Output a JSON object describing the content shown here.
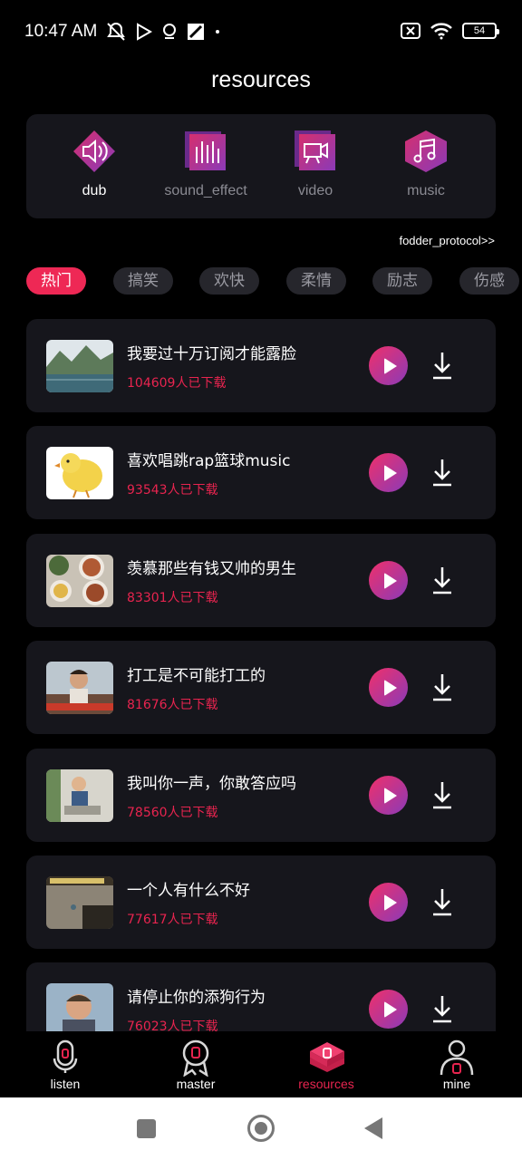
{
  "status": {
    "time": "10:47 AM",
    "battery": "54"
  },
  "title": "resources",
  "categories": [
    {
      "label": "dub",
      "icon": "speaker-icon"
    },
    {
      "label": "sound_effect",
      "icon": "equalizer-icon"
    },
    {
      "label": "video",
      "icon": "video-camera-icon"
    },
    {
      "label": "music",
      "icon": "music-note-icon"
    }
  ],
  "protocol_link": "fodder_protocol>>",
  "tabs": [
    "热门",
    "搞笑",
    "欢快",
    "柔情",
    "励志",
    "伤感"
  ],
  "items": [
    {
      "title": "我要过十万订阅才能露脸",
      "downloads": "104609人已下载"
    },
    {
      "title": "喜欢唱跳rap篮球music",
      "downloads": "93543人已下载"
    },
    {
      "title": "羡慕那些有钱又帅的男生",
      "downloads": "83301人已下载"
    },
    {
      "title": "打工是不可能打工的",
      "downloads": "81676人已下载"
    },
    {
      "title": "我叫你一声，你敢答应吗",
      "downloads": "78560人已下载"
    },
    {
      "title": "一个人有什么不好",
      "downloads": "77617人已下载"
    },
    {
      "title": "请停止你的添狗行为",
      "downloads": "76023人已下载"
    }
  ],
  "nav": [
    {
      "label": "listen",
      "icon": "microphone-icon"
    },
    {
      "label": "master",
      "icon": "medal-icon"
    },
    {
      "label": "resources",
      "icon": "layers-icon"
    },
    {
      "label": "mine",
      "icon": "person-icon"
    }
  ],
  "colors": {
    "accent": "#e8244f",
    "card": "#16161c",
    "background": "#000000"
  }
}
